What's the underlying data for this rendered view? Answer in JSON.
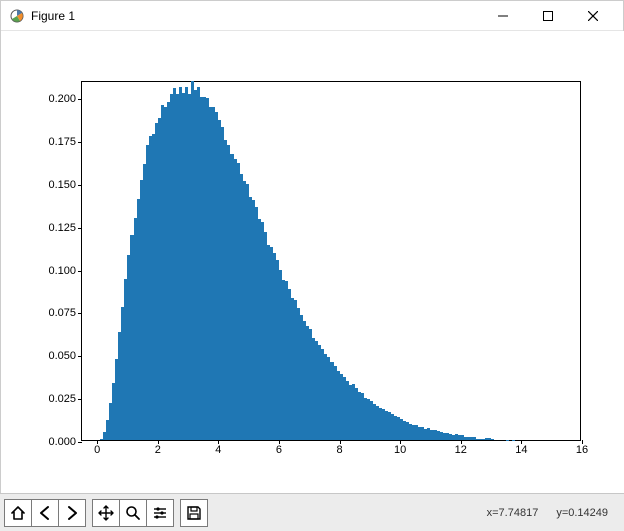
{
  "window": {
    "title": "Figure 1",
    "icon": "mpl-icon"
  },
  "toolbar": {
    "buttons": [
      {
        "name": "home-button",
        "icon": "home-icon"
      },
      {
        "name": "back-button",
        "icon": "arrow-left-icon"
      },
      {
        "name": "forward-button",
        "icon": "arrow-right-icon"
      },
      {
        "name": "pan-button",
        "icon": "move-icon"
      },
      {
        "name": "zoom-button",
        "icon": "magnifier-icon"
      },
      {
        "name": "subplots-button",
        "icon": "sliders-icon"
      },
      {
        "name": "save-button",
        "icon": "save-icon"
      }
    ]
  },
  "status": {
    "x_label": "x=7.74817",
    "y_label": "y=0.14249"
  },
  "chart_data": {
    "type": "bar",
    "title": "",
    "xlabel": "",
    "ylabel": "",
    "xlim": [
      -0.5,
      16
    ],
    "ylim": [
      0,
      0.21
    ],
    "yticks": [
      0.0,
      0.025,
      0.05,
      0.075,
      0.1,
      0.125,
      0.15,
      0.175,
      0.2
    ],
    "ytick_labels": [
      "0.000",
      "0.025",
      "0.050",
      "0.075",
      "0.100",
      "0.125",
      "0.150",
      "0.175",
      "0.200"
    ],
    "xticks": [
      0,
      2,
      4,
      6,
      8,
      10,
      12,
      14,
      16
    ],
    "xtick_labels": [
      "0",
      "2",
      "4",
      "6",
      "8",
      "10",
      "12",
      "14",
      "16"
    ],
    "bin_width": 0.1,
    "x": [
      0.0,
      0.1,
      0.2,
      0.3,
      0.4,
      0.5,
      0.6,
      0.7,
      0.8,
      0.9,
      1.0,
      1.1,
      1.2,
      1.3,
      1.4,
      1.5,
      1.6,
      1.7,
      1.8,
      1.9,
      2.0,
      2.1,
      2.2,
      2.3,
      2.4,
      2.5,
      2.6,
      2.7,
      2.8,
      2.9,
      3.0,
      3.1,
      3.2,
      3.3,
      3.4,
      3.5,
      3.6,
      3.7,
      3.8,
      3.9,
      4.0,
      4.1,
      4.2,
      4.3,
      4.4,
      4.5,
      4.6,
      4.7,
      4.8,
      4.9,
      5.0,
      5.1,
      5.2,
      5.3,
      5.4,
      5.5,
      5.6,
      5.7,
      5.8,
      5.9,
      6.0,
      6.1,
      6.2,
      6.3,
      6.4,
      6.5,
      6.6,
      6.7,
      6.8,
      6.9,
      7.0,
      7.1,
      7.2,
      7.3,
      7.4,
      7.5,
      7.6,
      7.7,
      7.8,
      7.9,
      8.0,
      8.1,
      8.2,
      8.3,
      8.4,
      8.5,
      8.6,
      8.7,
      8.8,
      8.9,
      9.0,
      9.1,
      9.2,
      9.3,
      9.4,
      9.5,
      9.6,
      9.7,
      9.8,
      9.9,
      10.0,
      10.1,
      10.2,
      10.3,
      10.4,
      10.5,
      10.6,
      10.7,
      10.8,
      10.9,
      11.0,
      11.1,
      11.2,
      11.3,
      11.4,
      11.5,
      11.6,
      11.7,
      11.8,
      11.9,
      12.0,
      12.1,
      12.2,
      12.3,
      12.4,
      12.5,
      12.6,
      12.7,
      12.8,
      12.9,
      13.0,
      13.1,
      13.2,
      13.3,
      13.4,
      13.5,
      13.6,
      13.7,
      13.8,
      13.9,
      14.0,
      14.1,
      14.2,
      14.3,
      14.4,
      14.5,
      14.6,
      14.7,
      14.8,
      14.9,
      15.0,
      15.1,
      15.2,
      15.3,
      15.4,
      15.5,
      15.6,
      15.7,
      15.8,
      15.9,
      16.0
    ],
    "values": [
      0.0,
      0.002,
      0.006,
      0.013,
      0.023,
      0.035,
      0.049,
      0.064,
      0.079,
      0.094,
      0.108,
      0.121,
      0.133,
      0.144,
      0.154,
      0.162,
      0.17,
      0.177,
      0.182,
      0.187,
      0.191,
      0.195,
      0.198,
      0.2,
      0.202,
      0.204,
      0.205,
      0.206,
      0.207,
      0.207,
      0.207,
      0.207,
      0.206,
      0.205,
      0.204,
      0.202,
      0.2,
      0.197,
      0.194,
      0.191,
      0.187,
      0.183,
      0.179,
      0.175,
      0.171,
      0.167,
      0.162,
      0.158,
      0.153,
      0.149,
      0.144,
      0.14,
      0.135,
      0.131,
      0.126,
      0.122,
      0.117,
      0.113,
      0.109,
      0.104,
      0.1,
      0.096,
      0.092,
      0.089,
      0.085,
      0.081,
      0.078,
      0.075,
      0.071,
      0.068,
      0.065,
      0.062,
      0.059,
      0.057,
      0.054,
      0.051,
      0.049,
      0.047,
      0.044,
      0.042,
      0.04,
      0.038,
      0.036,
      0.034,
      0.033,
      0.031,
      0.029,
      0.028,
      0.026,
      0.025,
      0.024,
      0.022,
      0.021,
      0.02,
      0.019,
      0.018,
      0.017,
      0.016,
      0.015,
      0.014,
      0.013,
      0.012,
      0.012,
      0.011,
      0.01,
      0.01,
      0.009,
      0.009,
      0.008,
      0.008,
      0.007,
      0.007,
      0.006,
      0.006,
      0.005,
      0.005,
      0.005,
      0.004,
      0.004,
      0.004,
      0.004,
      0.003,
      0.003,
      0.003,
      0.003,
      0.002,
      0.002,
      0.002,
      0.002,
      0.002,
      0.002,
      0.001,
      0.001,
      0.001,
      0.001,
      0.001,
      0.001,
      0.001,
      0.001,
      0.001,
      0.001,
      0.0,
      0.0,
      0.0,
      0.0,
      0.0,
      0.0,
      0.0,
      0.0,
      0.0,
      0.0,
      0.0,
      0.0,
      0.0,
      0.0,
      0.0,
      0.0,
      0.0,
      0.0,
      0.0,
      0.0
    ],
    "color": "#1f77b4"
  }
}
